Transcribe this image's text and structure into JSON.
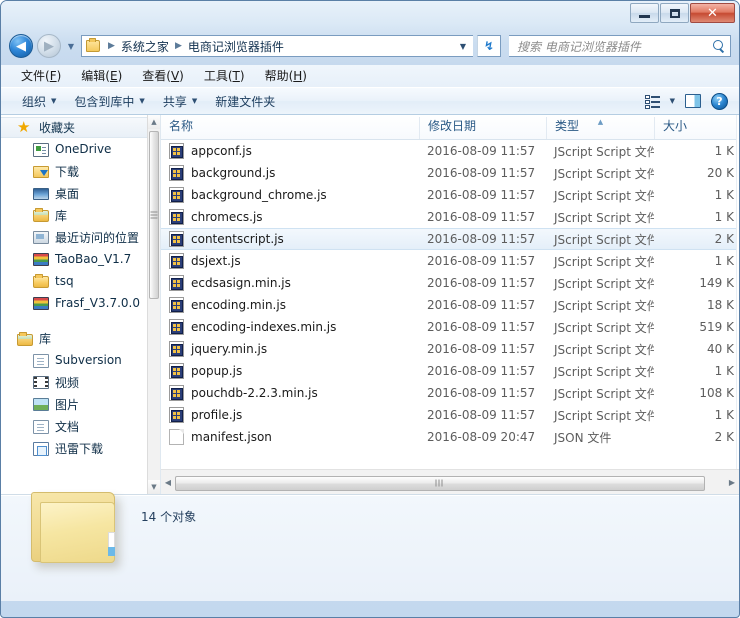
{
  "window": {
    "controls": {
      "minimize": "最小化",
      "maximize": "最大化",
      "close": "✕"
    }
  },
  "address": {
    "back_label": "◀",
    "forward_label": "▶",
    "history_caret": "▼",
    "folder_icon": "folder-icon",
    "crumbs": [
      "系统之家",
      "电商记浏览器插件"
    ],
    "separator": "▶",
    "dropdown_caret": "▼",
    "refresh_label": "↯"
  },
  "search": {
    "placeholder": "搜索 电商记浏览器插件",
    "value": ""
  },
  "menubar": {
    "items": [
      {
        "text": "文件(F)",
        "pre": "文件(",
        "key": "F",
        "post": ")"
      },
      {
        "text": "编辑(E)",
        "pre": "编辑(",
        "key": "E",
        "post": ")"
      },
      {
        "text": "查看(V)",
        "pre": "查看(",
        "key": "V",
        "post": ")"
      },
      {
        "text": "工具(T)",
        "pre": "工具(",
        "key": "T",
        "post": ")"
      },
      {
        "text": "帮助(H)",
        "pre": "帮助(",
        "key": "H",
        "post": ")"
      }
    ]
  },
  "toolbar": {
    "organize": "组织",
    "include_in_library": "包含到库中",
    "share": "共享",
    "new_folder": "新建文件夹",
    "caret": "▼",
    "view_icon": "view-options-icon",
    "pane_icon": "preview-pane-icon",
    "help_icon": "help-icon",
    "help_glyph": "?"
  },
  "sidebar": {
    "favorites": {
      "label": "收藏夹",
      "icon": "star-icon",
      "star_glyph": "★",
      "items": [
        {
          "label": "OneDrive",
          "icon": "onedrive-icon"
        },
        {
          "label": "下载",
          "icon": "downloads-icon"
        },
        {
          "label": "桌面",
          "icon": "desktop-icon"
        },
        {
          "label": "库",
          "icon": "library-icon"
        },
        {
          "label": "最近访问的位置",
          "icon": "recent-places-icon"
        },
        {
          "label": "TaoBao_V1.7",
          "icon": "archive-icon"
        },
        {
          "label": "tsq",
          "icon": "folder-icon"
        },
        {
          "label": "Frasf_V3.7.0.0",
          "icon": "archive-icon"
        }
      ]
    },
    "libraries": {
      "label": "库",
      "icon": "library-icon",
      "items": [
        {
          "label": "Subversion",
          "icon": "document-icon"
        },
        {
          "label": "视频",
          "icon": "video-icon"
        },
        {
          "label": "图片",
          "icon": "picture-icon"
        },
        {
          "label": "文档",
          "icon": "documents-icon"
        },
        {
          "label": "迅雷下载",
          "icon": "xunlei-icon"
        }
      ]
    },
    "scroll_up": "▲",
    "scroll_down": "▼"
  },
  "filelist": {
    "columns": [
      {
        "label": "名称",
        "sorted": false
      },
      {
        "label": "修改日期",
        "sorted": false
      },
      {
        "label": "类型",
        "sorted": true
      },
      {
        "label": "大小",
        "sorted": false
      }
    ],
    "sort_caret": "▲",
    "rows": [
      {
        "name": "appconf.js",
        "date": "2016-08-09 11:57",
        "type": "JScript Script 文件",
        "size": "1 K",
        "icon": "jscript-file-icon",
        "selected": false
      },
      {
        "name": "background.js",
        "date": "2016-08-09 11:57",
        "type": "JScript Script 文件",
        "size": "20 K",
        "icon": "jscript-file-icon",
        "selected": false
      },
      {
        "name": "background_chrome.js",
        "date": "2016-08-09 11:57",
        "type": "JScript Script 文件",
        "size": "1 K",
        "icon": "jscript-file-icon",
        "selected": false
      },
      {
        "name": "chromecs.js",
        "date": "2016-08-09 11:57",
        "type": "JScript Script 文件",
        "size": "1 K",
        "icon": "jscript-file-icon",
        "selected": false
      },
      {
        "name": "contentscript.js",
        "date": "2016-08-09 11:57",
        "type": "JScript Script 文件",
        "size": "2 K",
        "icon": "jscript-file-icon",
        "selected": true
      },
      {
        "name": "dsjext.js",
        "date": "2016-08-09 11:57",
        "type": "JScript Script 文件",
        "size": "1 K",
        "icon": "jscript-file-icon",
        "selected": false
      },
      {
        "name": "ecdsasign.min.js",
        "date": "2016-08-09 11:57",
        "type": "JScript Script 文件",
        "size": "149 K",
        "icon": "jscript-file-icon",
        "selected": false
      },
      {
        "name": "encoding.min.js",
        "date": "2016-08-09 11:57",
        "type": "JScript Script 文件",
        "size": "18 K",
        "icon": "jscript-file-icon",
        "selected": false
      },
      {
        "name": "encoding-indexes.min.js",
        "date": "2016-08-09 11:57",
        "type": "JScript Script 文件",
        "size": "519 K",
        "icon": "jscript-file-icon",
        "selected": false
      },
      {
        "name": "jquery.min.js",
        "date": "2016-08-09 11:57",
        "type": "JScript Script 文件",
        "size": "40 K",
        "icon": "jscript-file-icon",
        "selected": false
      },
      {
        "name": "popup.js",
        "date": "2016-08-09 11:57",
        "type": "JScript Script 文件",
        "size": "1 K",
        "icon": "jscript-file-icon",
        "selected": false
      },
      {
        "name": "pouchdb-2.2.3.min.js",
        "date": "2016-08-09 11:57",
        "type": "JScript Script 文件",
        "size": "108 K",
        "icon": "jscript-file-icon",
        "selected": false
      },
      {
        "name": "profile.js",
        "date": "2016-08-09 11:57",
        "type": "JScript Script 文件",
        "size": "1 K",
        "icon": "jscript-file-icon",
        "selected": false
      },
      {
        "name": "manifest.json",
        "date": "2016-08-09 20:47",
        "type": "JSON 文件",
        "size": "2 K",
        "icon": "json-file-icon",
        "selected": false
      }
    ],
    "hscroll_left": "◀",
    "hscroll_right": "▶"
  },
  "statusbar": {
    "text": "14 个对象",
    "folder_icon": "large-folder-icon"
  }
}
